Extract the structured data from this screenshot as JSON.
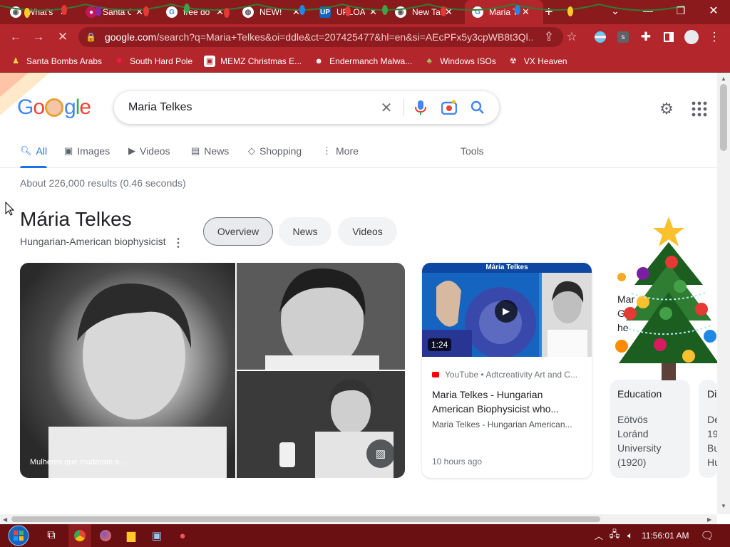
{
  "browser": {
    "tabs": [
      {
        "title": "What's",
        "icon": "chrome-icon"
      },
      {
        "title": "Santa C",
        "icon": "red-icon"
      },
      {
        "title": "free do",
        "icon": "google-icon"
      },
      {
        "title": "NEW!",
        "icon": "globe-icon"
      },
      {
        "title": "UPLOA",
        "icon": "up-icon"
      },
      {
        "title": "New Ta",
        "icon": "chrome-icon"
      },
      {
        "title": "Maria T",
        "icon": "google-icon"
      }
    ],
    "url_domain": "google.com",
    "url_rest": "/search?q=Maria+Telkes&oi=ddle&ct=207425477&hl=en&si=AEcPFx5y3cpWB8t3Ql...",
    "bookmarks": [
      {
        "label": "Santa Bombs Arabs"
      },
      {
        "label": "South Hard Pole"
      },
      {
        "label": "MEMZ Christmas E..."
      },
      {
        "label": "Endermanch Malwa..."
      },
      {
        "label": "Windows ISOs"
      },
      {
        "label": "VX Heaven"
      }
    ],
    "colors": {
      "frame": "#b3262b",
      "tabstrip": "#8b1a1d",
      "taskbar": "#6a0f12"
    }
  },
  "google": {
    "logo": "Google",
    "query": "Maria Telkes",
    "tabs": [
      {
        "label": "All",
        "icon": "search-icon"
      },
      {
        "label": "Images",
        "icon": "image-icon"
      },
      {
        "label": "Videos",
        "icon": "play-icon"
      },
      {
        "label": "News",
        "icon": "news-icon"
      },
      {
        "label": "Shopping",
        "icon": "tag-icon"
      },
      {
        "label": "More",
        "icon": "more-icon"
      }
    ],
    "tools": "Tools",
    "stats": "About 226,000 results (0.46 seconds)",
    "accent": "#1a73e8"
  },
  "knowledge_panel": {
    "title": "Mária Telkes",
    "subtitle": "Hungarian-American biophysicist",
    "chips": [
      "Overview",
      "News",
      "Videos"
    ],
    "image_caption": "Mulheres que mudaram a ...",
    "video": {
      "banner": "Mária Telkes",
      "duration": "1:24",
      "source": "YouTube • Adtcreativity Art and C...",
      "title": "Maria Telkes - Hungarian American Biophysicist who...",
      "snippet": "Maria Telkes - Hungarian American...",
      "time": "10 hours ago"
    },
    "partial_card": "Mar G he",
    "education": {
      "label": "Education",
      "value": "Eötvös Loránd University (1920)"
    },
    "partial_card2": {
      "label": "Di",
      "value": "De 19 Bu Hu"
    }
  },
  "taskbar": {
    "clock": "11:56:01 AM"
  }
}
